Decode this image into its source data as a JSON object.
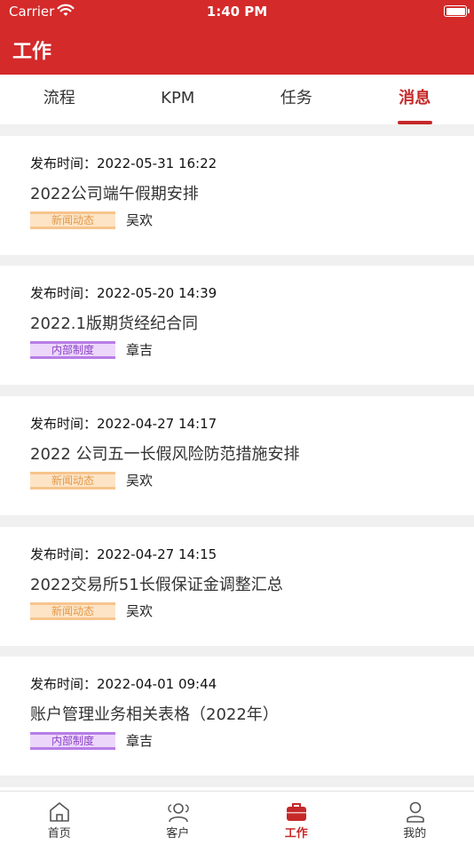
{
  "status_bar": {
    "carrier": "Carrier",
    "time": "1:40 PM"
  },
  "header": {
    "title": "工作"
  },
  "tabs": [
    {
      "label": "流程",
      "active": false
    },
    {
      "label": "KPM",
      "active": false
    },
    {
      "label": "任务",
      "active": false
    },
    {
      "label": "消息",
      "active": true
    }
  ],
  "messages": [
    {
      "time": "发布时间：2022-05-31 16:22",
      "title": "2022公司端午假期安排",
      "tag": "新闻动态",
      "tag_type": "news",
      "author": "吴欢"
    },
    {
      "time": "发布时间：2022-05-20 14:39",
      "title": "2022.1版期货经纪合同",
      "tag": "内部制度",
      "tag_type": "policy",
      "author": "章吉"
    },
    {
      "time": "发布时间：2022-04-27 14:17",
      "title": "2022 公司五一长假风险防范措施安排",
      "tag": "新闻动态",
      "tag_type": "news",
      "author": "吴欢"
    },
    {
      "time": "发布时间：2022-04-27 14:15",
      "title": "2022交易所51长假保证金调整汇总",
      "tag": "新闻动态",
      "tag_type": "news",
      "author": "吴欢"
    },
    {
      "time": "发布时间：2022-04-01 09:44",
      "title": "账户管理业务相关表格（2022年）",
      "tag": "内部制度",
      "tag_type": "policy",
      "author": "章吉"
    }
  ],
  "bottom_nav": [
    {
      "label": "首页",
      "icon": "home-icon",
      "active": false
    },
    {
      "label": "客户",
      "icon": "customers-icon",
      "active": false
    },
    {
      "label": "工作",
      "icon": "briefcase-icon",
      "active": true
    },
    {
      "label": "我的",
      "icon": "profile-icon",
      "active": false
    }
  ],
  "colors": {
    "brand": "#d42a2a",
    "accent": "#c62828",
    "news_tag": "#e29a4b",
    "policy_tag": "#8a3fc7"
  }
}
